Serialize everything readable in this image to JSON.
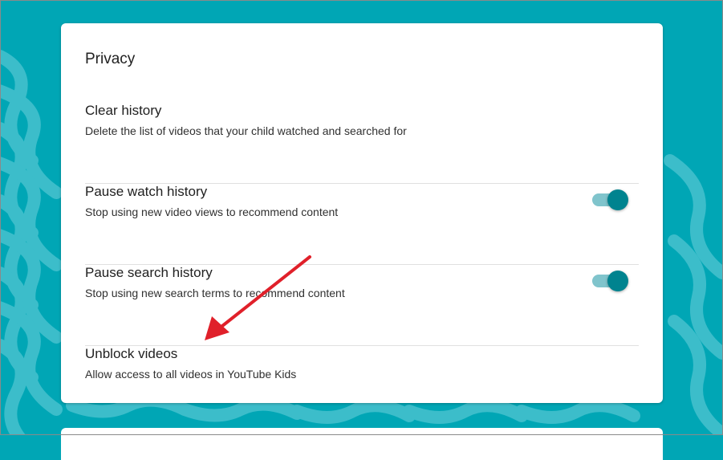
{
  "privacy": {
    "section_title": "Privacy",
    "items": [
      {
        "title": "Clear history",
        "description": "Delete the list of videos that your child watched and searched for",
        "has_toggle": false
      },
      {
        "title": "Pause watch history",
        "description": "Stop using new video views to recommend content",
        "has_toggle": true,
        "toggle_on": true
      },
      {
        "title": "Pause search history",
        "description": "Stop using new search terms to recommend content",
        "has_toggle": true,
        "toggle_on": true
      },
      {
        "title": "Unblock videos",
        "description": "Allow access to all videos in YouTube Kids",
        "has_toggle": false
      }
    ]
  },
  "colors": {
    "background": "#00a6b5",
    "wave": "#3cbdca",
    "card": "#ffffff",
    "toggle_knob": "#00838f",
    "toggle_track": "#80c4cc",
    "annotation_arrow": "#e0202a"
  },
  "annotation": {
    "type": "arrow",
    "target": "Unblock videos"
  }
}
